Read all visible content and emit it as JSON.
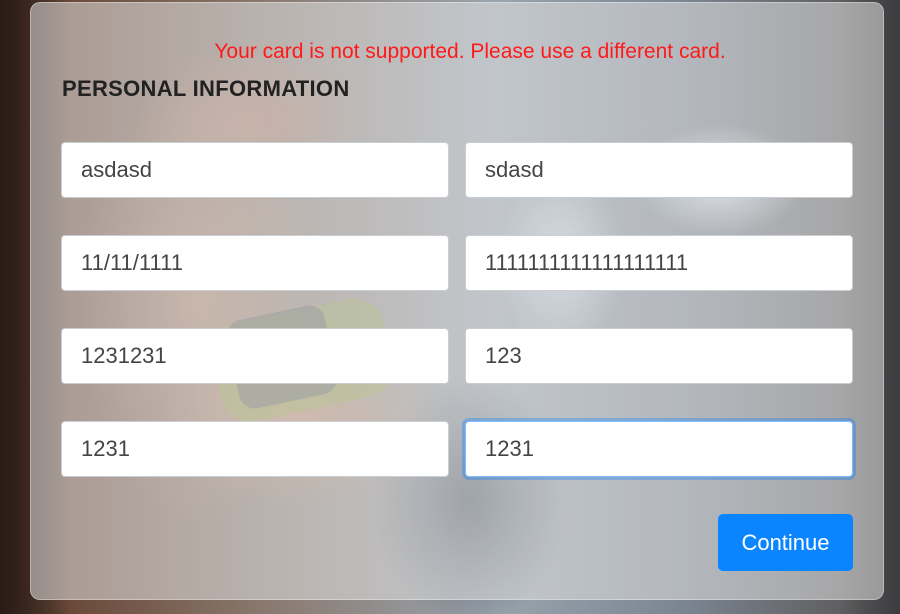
{
  "error_message": "Your card is not supported. Please use a different card.",
  "section_title": "PERSONAL INFORMATION",
  "fields": {
    "first_name": "asdasd",
    "last_name": "sdasd",
    "date_of_birth": "11/11/1111",
    "card_number": "1111111111111111111",
    "field_5": "1231231",
    "field_6": "123",
    "field_7": "1231",
    "field_8": "1231"
  },
  "continue_label": "Continue",
  "colors": {
    "error": "#ff1a1a",
    "primary_button": "#0a84ff",
    "focus_border": "#80bdff"
  }
}
